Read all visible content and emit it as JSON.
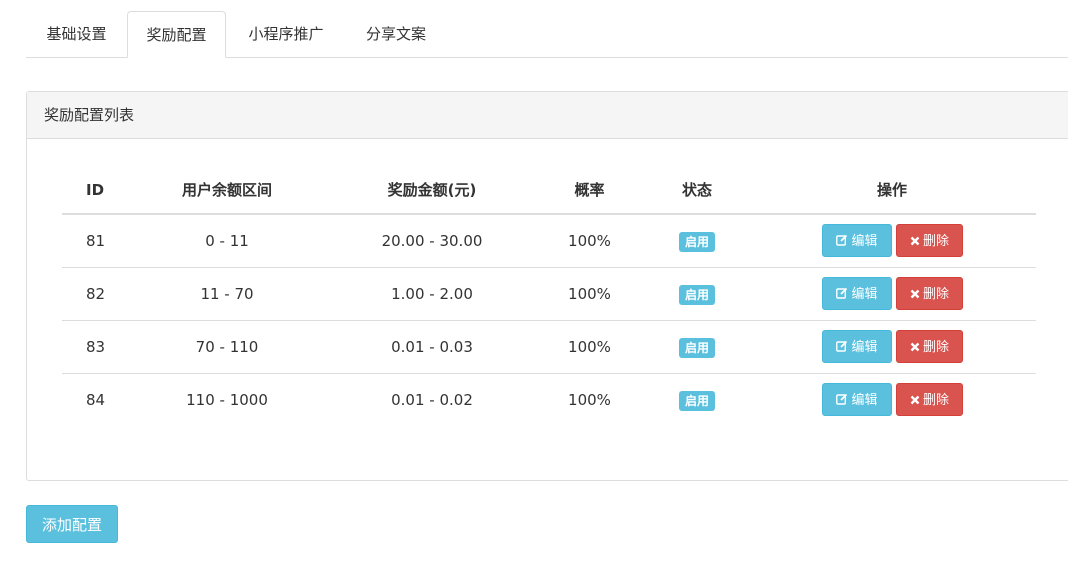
{
  "tabs": [
    {
      "label": "基础设置",
      "active": false
    },
    {
      "label": "奖励配置",
      "active": true
    },
    {
      "label": "小程序推广",
      "active": false
    },
    {
      "label": "分享文案",
      "active": false
    }
  ],
  "panel": {
    "title": "奖励配置列表",
    "columns": [
      "ID",
      "用户余额区间",
      "奖励金额(元)",
      "概率",
      "状态",
      "操作"
    ],
    "rows": [
      {
        "id": "81",
        "range": "0 - 11",
        "amount": "20.00 - 30.00",
        "rate": "100%",
        "status": "启用"
      },
      {
        "id": "82",
        "range": "11 - 70",
        "amount": "1.00 - 2.00",
        "rate": "100%",
        "status": "启用"
      },
      {
        "id": "83",
        "range": "70 - 110",
        "amount": "0.01 - 0.03",
        "rate": "100%",
        "status": "启用"
      },
      {
        "id": "84",
        "range": "110 - 1000",
        "amount": "0.01 - 0.02",
        "rate": "100%",
        "status": "启用"
      }
    ],
    "edit_label": "编辑",
    "delete_label": "删除"
  },
  "add_button": "添加配置",
  "colors": {
    "info": "#5bc0de",
    "danger": "#d9534f",
    "border": "#dddddd",
    "heading_bg": "#f5f5f5"
  },
  "icons": {
    "edit": "pencil-square-icon",
    "delete": "times-icon"
  }
}
